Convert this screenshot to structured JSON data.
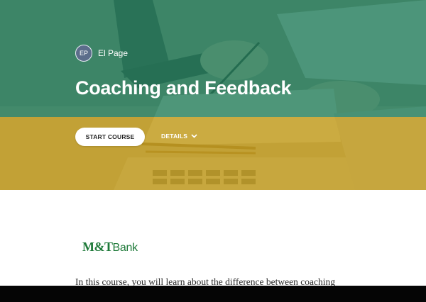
{
  "course": {
    "author_initials": "EP",
    "author_name": "El Page",
    "title": "Coaching and Feedback",
    "start_button": "START COURSE",
    "details_label": "DETAILS",
    "description": "In this course, you will learn about the difference between coaching"
  },
  "logo": {
    "mt": "M&T",
    "bank": "Bank"
  },
  "icons": {
    "details_toggle": "chevron-down-icon"
  },
  "colors": {
    "green_overlay": "#26805c",
    "gold_overlay": "#c49d20",
    "logo_green": "#1f7a3a",
    "footer_bar": "#050505"
  }
}
